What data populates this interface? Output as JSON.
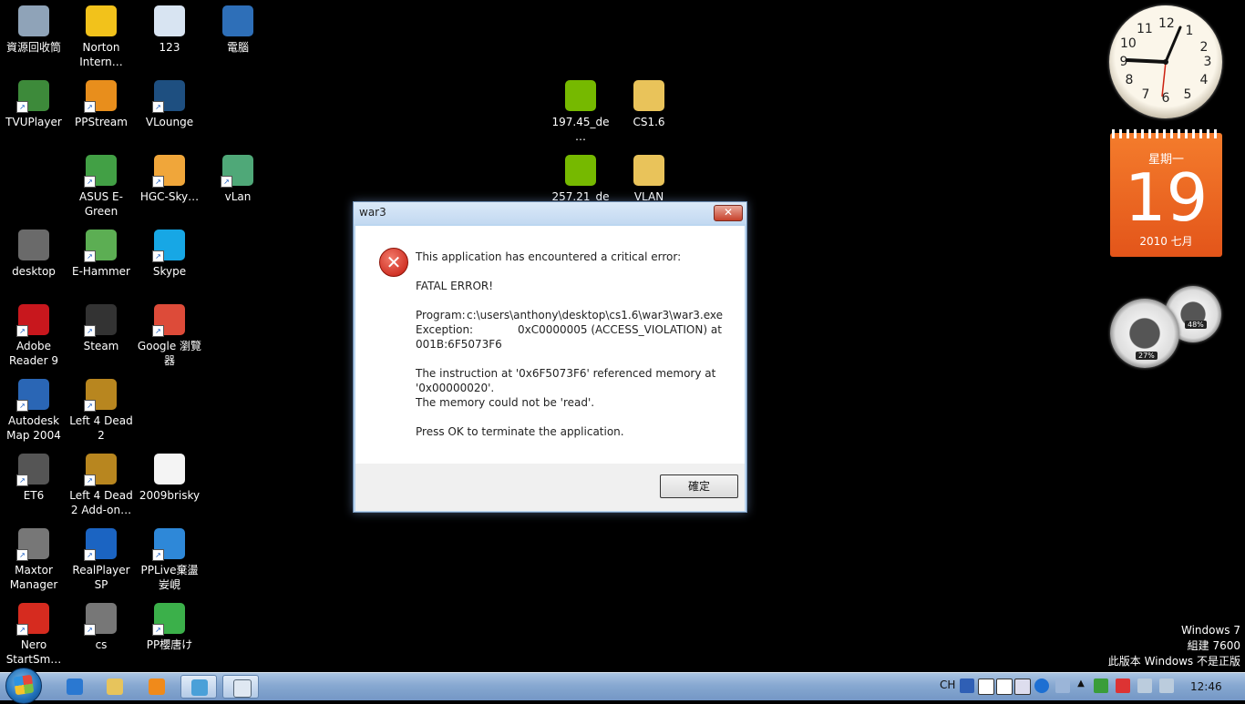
{
  "desktop_icons": [
    {
      "name": "recycle-bin-icon",
      "label": "資源回收筒",
      "color": "#8fa3b8"
    },
    {
      "name": "norton-icon",
      "label": "Norton Intern…",
      "color": "#f2c21b"
    },
    {
      "name": "calendar-file-icon",
      "label": "123",
      "color": "#d8e4f2"
    },
    {
      "name": "computer-icon",
      "label": "電腦",
      "color": "#2e6fb8"
    },
    {
      "name": "tvuplayer-icon",
      "label": "TVUPlayer",
      "color": "#3d8a3a"
    },
    {
      "name": "ppstream-icon",
      "label": "PPStream",
      "color": "#e88e1c"
    },
    {
      "name": "vlounge-icon",
      "label": "VLounge",
      "color": "#1e4f80"
    },
    {
      "name": "asus-egreen-icon",
      "label": "ASUS E-Green",
      "color": "#42a045"
    },
    {
      "name": "hgc-sky-icon",
      "label": "HGC-Sky…",
      "color": "#f0a63a"
    },
    {
      "name": "vlan-icon",
      "label": "vLan",
      "color": "#4fa878"
    },
    {
      "name": "desktop-icon",
      "label": "desktop",
      "color": "#6a6a6a"
    },
    {
      "name": "e-hammer-icon",
      "label": "E-Hammer",
      "color": "#5cae53"
    },
    {
      "name": "skype-icon",
      "label": "Skype",
      "color": "#17a7e5"
    },
    {
      "name": "adobe-reader-icon",
      "label": "Adobe Reader 9",
      "color": "#c8171d"
    },
    {
      "name": "steam-icon",
      "label": "Steam",
      "color": "#333333"
    },
    {
      "name": "chrome-icon",
      "label": "Google 瀏覽器",
      "color": "#dd4b39"
    },
    {
      "name": "autodesk-icon",
      "label": "Autodesk Map 2004",
      "color": "#2a66b5"
    },
    {
      "name": "left4dead2-icon",
      "label": "Left 4 Dead 2",
      "color": "#b8861f"
    },
    {
      "name": "et6-icon",
      "label": "ET6",
      "color": "#555555"
    },
    {
      "name": "left4dead2-addon-icon",
      "label": "Left 4 Dead 2 Add-on…",
      "color": "#b8861f"
    },
    {
      "name": "brisky-file-icon",
      "label": "2009brisky",
      "color": "#f4f4f4"
    },
    {
      "name": "maxtor-icon",
      "label": "Maxtor Manager",
      "color": "#777777"
    },
    {
      "name": "realplayer-icon",
      "label": "RealPlayer SP",
      "color": "#1b64c2"
    },
    {
      "name": "pplive-icon",
      "label": "PPLive棄盪妛峴",
      "color": "#2e88d8"
    },
    {
      "name": "nero-icon",
      "label": "Nero StartSm…",
      "color": "#d62b1f"
    },
    {
      "name": "cs-icon",
      "label": "cs",
      "color": "#777777"
    },
    {
      "name": "pp-icon",
      "label": "PP櫻唐け",
      "color": "#3bb04a"
    },
    {
      "name": "nvidia-driver-197-icon",
      "label": "197.45_de…",
      "color": "#76b900"
    },
    {
      "name": "cs16-folder-icon",
      "label": "CS1.6",
      "color": "#e9c35a"
    },
    {
      "name": "nvidia-driver-257-icon",
      "label": "257.21_de…",
      "color": "#76b900"
    },
    {
      "name": "vlan-folder-icon",
      "label": "VLAN",
      "color": "#e9c35a"
    }
  ],
  "dialog": {
    "title": "war3",
    "close_label": "✕",
    "intro": "This application has encountered a critical error:",
    "fatal": "FATAL ERROR!",
    "program_label": "Program:",
    "program_value": "c:\\users\\anthony\\desktop\\cs1.6\\war3\\war3.exe",
    "exception_label": "Exception:",
    "exception_value": "0xC0000005 (ACCESS_VIOLATION) at",
    "exception_addr": "001B:6F5073F6",
    "instruction_line1": "The instruction at '0x6F5073F6' referenced memory at",
    "instruction_line2": "'0x00000020'.",
    "instruction_line3": "The memory could not be 'read'.",
    "press_ok": "Press OK to terminate the application.",
    "ok_label": "確定"
  },
  "gadgets": {
    "clock_numbers": [
      "12",
      "1",
      "2",
      "3",
      "4",
      "5",
      "6",
      "7",
      "8",
      "9",
      "10",
      "11"
    ],
    "calendar": {
      "weekday": "星期一",
      "day": "19",
      "year_month": "2010 七月"
    },
    "cpu_percent": "27%",
    "mem_percent": "48%"
  },
  "watermark": {
    "line1": "Windows 7",
    "line2": "組建 7600",
    "line3": "此版本 Windows 不是正版"
  },
  "taskbar": {
    "language": "CH",
    "clock": "12:46"
  }
}
